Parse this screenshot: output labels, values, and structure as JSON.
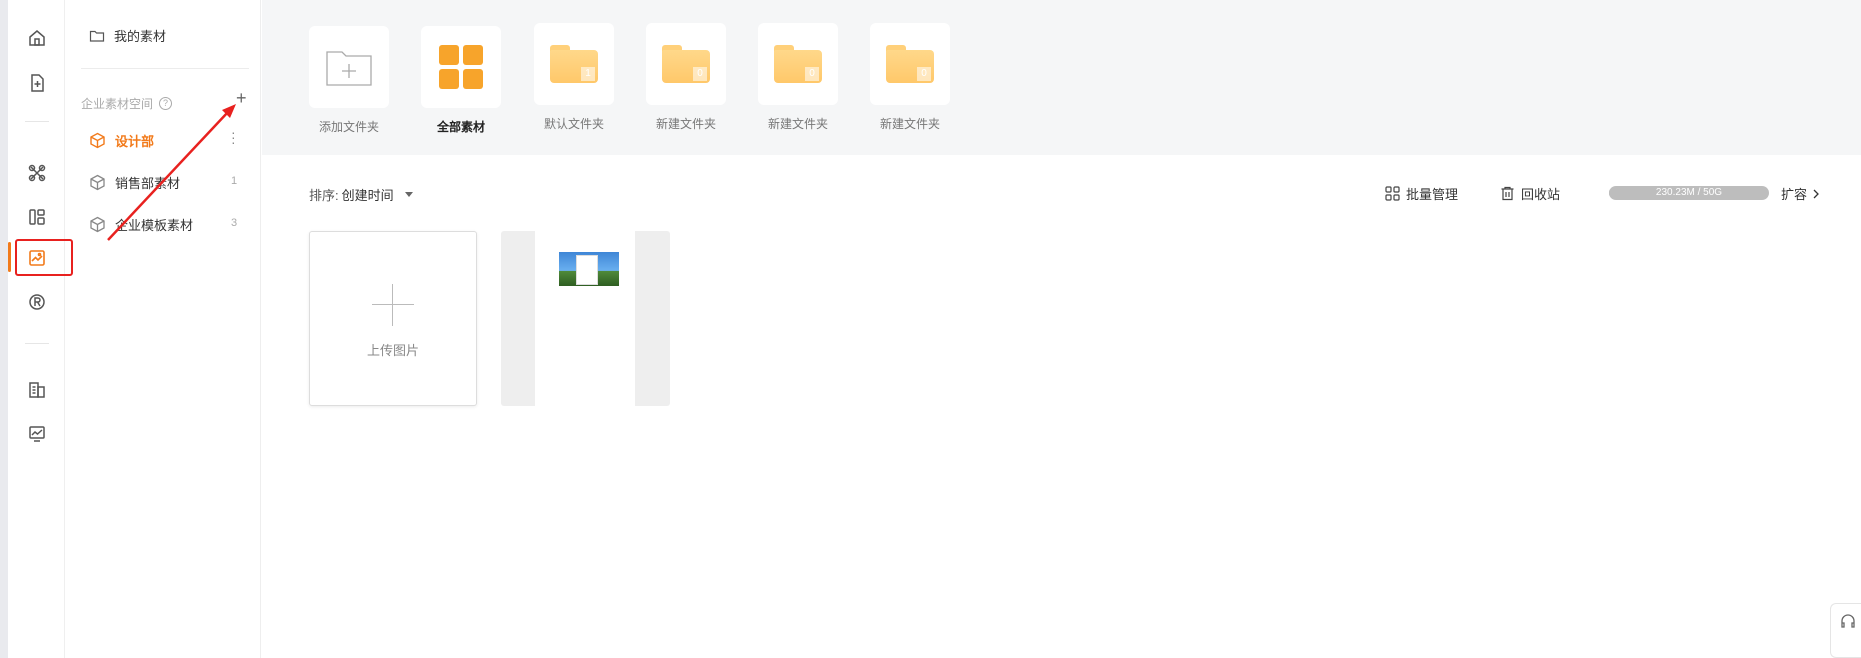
{
  "sidebar": {
    "my_materials": "我的素材",
    "space_title": "企业素材空间",
    "help_glyph": "?",
    "add_glyph": "+",
    "groups": [
      {
        "label": "设计部",
        "count": "",
        "active": true
      },
      {
        "label": "销售部素材",
        "count": "1",
        "active": false
      },
      {
        "label": "企业模板素材",
        "count": "3",
        "active": false
      }
    ]
  },
  "rail": {
    "icons": [
      "home-icon",
      "new-doc-icon",
      "tools-icon",
      "layout-icon",
      "image-icon",
      "registered-icon",
      "building-icon",
      "chart-icon"
    ],
    "active_icon": "image-icon"
  },
  "folders": {
    "add_label": "添加文件夹",
    "all_label": "全部素材",
    "items": [
      {
        "label": "默认文件夹",
        "count": "1"
      },
      {
        "label": "新建文件夹",
        "count": "0"
      },
      {
        "label": "新建文件夹",
        "count": "0"
      },
      {
        "label": "新建文件夹",
        "count": "0"
      }
    ]
  },
  "toolbar": {
    "sort_label": "排序:",
    "sort_value": "创建时间",
    "batch_label": "批量管理",
    "recycle_label": "回收站",
    "quota_text": "230.23M / 50G",
    "quota_fraction": 0.0046,
    "expand_label": "扩容"
  },
  "cards": {
    "upload_label": "上传图片"
  },
  "colors": {
    "accent": "#f27a1a",
    "annotation_red": "#e8211f",
    "folder": "#ffc86a"
  }
}
